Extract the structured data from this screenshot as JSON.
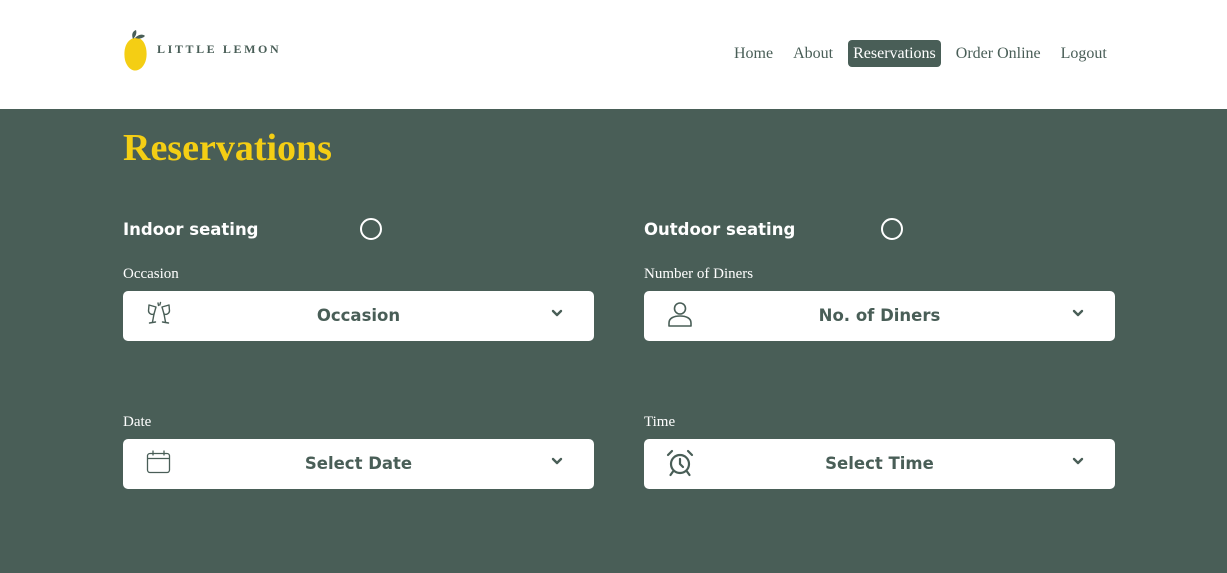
{
  "header": {
    "logo_text": "LITTLE LEMON",
    "nav": [
      {
        "label": "Home"
      },
      {
        "label": "About"
      },
      {
        "label": "Reservations",
        "active": true
      },
      {
        "label": "Order Online"
      },
      {
        "label": "Logout"
      }
    ]
  },
  "main": {
    "title": "Reservations",
    "seating": {
      "indoor_label": "Indoor seating",
      "outdoor_label": "Outdoor seating"
    },
    "fields": {
      "occasion": {
        "label": "Occasion",
        "value": "Occasion",
        "icon": "champagne-glasses-icon"
      },
      "diners": {
        "label": "Number of Diners",
        "value": "No. of Diners",
        "icon": "person-icon"
      },
      "date": {
        "label": "Date",
        "value": "Select Date",
        "icon": "calendar-icon"
      },
      "time": {
        "label": "Time",
        "value": "Select Time",
        "icon": "alarm-clock-icon"
      }
    }
  },
  "colors": {
    "primary": "#495e57",
    "accent": "#f4ce14",
    "white": "#ffffff"
  }
}
